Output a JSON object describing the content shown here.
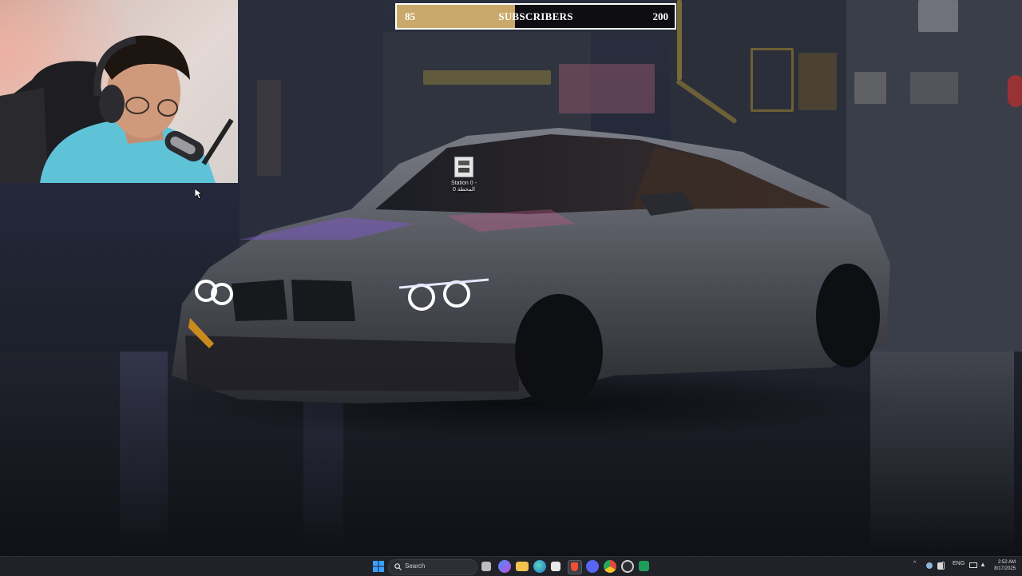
{
  "subscribers": {
    "current": "85",
    "title": "SUBSCRIBERS",
    "goal": "200",
    "progress_fraction": 0.425,
    "fill_color": "#c9a96b"
  },
  "desktop": {
    "icon_label_line1": "Station 0 -",
    "icon_label_line2": "0 المحطة"
  },
  "taskbar": {
    "search_placeholder": "Search",
    "language": "ENG",
    "time": "2:52 AM",
    "date": "8/17/2025",
    "apps": [
      {
        "name": "start-icon",
        "color": "#3aa0ff"
      },
      {
        "name": "task-view-icon",
        "color": "#bcbcbc"
      },
      {
        "name": "copilot-icon",
        "color": "#7b6cff"
      },
      {
        "name": "file-explorer-icon",
        "color": "#f2c14e"
      },
      {
        "name": "edge-icon",
        "color": "#2fb3a8"
      },
      {
        "name": "store-icon",
        "color": "#e8e8e8"
      },
      {
        "name": "brave-icon",
        "color": "#f0502f"
      },
      {
        "name": "discord-icon",
        "color": "#5865f2"
      },
      {
        "name": "chrome-icon",
        "color": "#e0483c"
      },
      {
        "name": "obs-icon",
        "color": "#d0d0d0"
      },
      {
        "name": "excel-icon",
        "color": "#1e9e5a"
      }
    ]
  }
}
